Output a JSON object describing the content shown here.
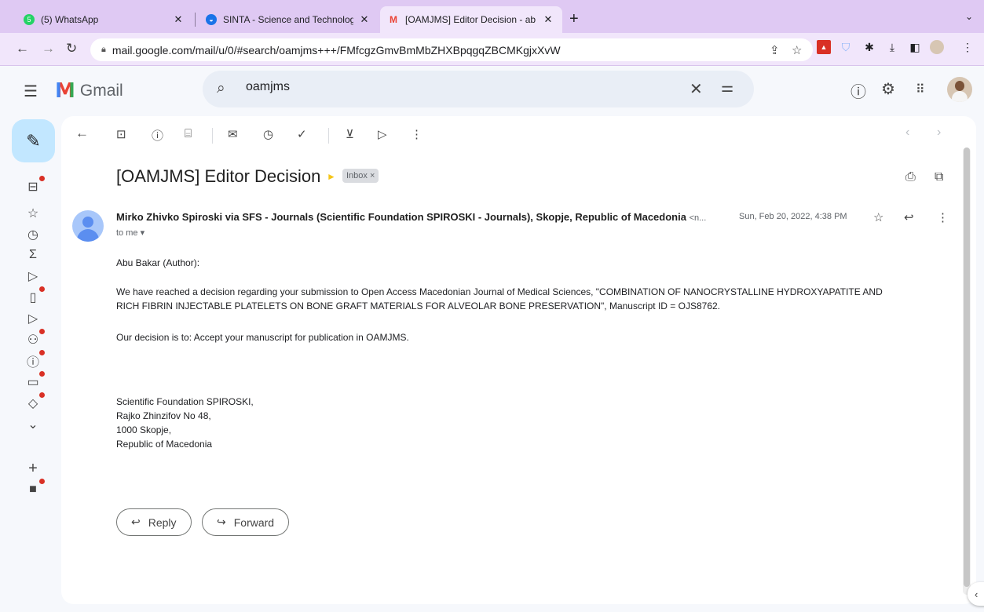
{
  "browser": {
    "tabs": [
      {
        "title": "(5) WhatsApp",
        "icon": "whatsapp-icon",
        "active": false
      },
      {
        "title": "SINTA - Science and Technolog",
        "icon": "sinta-icon",
        "active": false
      },
      {
        "title": "[OAMJMS] Editor Decision - ab",
        "icon": "gmail-icon",
        "active": true
      }
    ],
    "new_tab": "+",
    "url": "mail.google.com/mail/u/0/#search/oamjms+++/FMfcgzGmvBmMbZHXBpqgqZBCMKgjxXvW"
  },
  "gmail": {
    "brand": "Gmail",
    "search_value": "oamjms",
    "accent": "#c2e7ff"
  },
  "email": {
    "subject": "[OAMJMS] Editor Decision",
    "label": "Inbox ×",
    "sender_name": "Mirko Zhivko Spiroski via SFS - Journals (Scientific Foundation SPIROSKI - Journals), Skopje, Republic of Macedonia",
    "sender_addr": "<n...",
    "date": "Sun, Feb 20, 2022, 4:38 PM",
    "to": "to me ▾",
    "greeting": "Abu Bakar (Author):",
    "paragraph1_line1": "We have reached a decision regarding your submission to Open Access Macedonian Journal of Medical Sciences, \"COMBINATION OF NANOCRYSTALLINE HYDROXYAPATITE AND",
    "paragraph1_line2": "RICH FIBRIN INJECTABLE PLATELETS ON BONE GRAFT MATERIALS FOR ALVEOLAR BONE PRESERVATION\", Manuscript ID = OJS8762.",
    "decision": "Our decision is to: Accept your manuscript for publication in OAMJMS.",
    "signature": [
      "Scientific Foundation SPIROSKI,",
      "Rajko Zhinzifov No 48,",
      "1000 Skopje,",
      "Republic of Macedonia"
    ],
    "reply_label": "Reply",
    "forward_label": "Forward"
  }
}
